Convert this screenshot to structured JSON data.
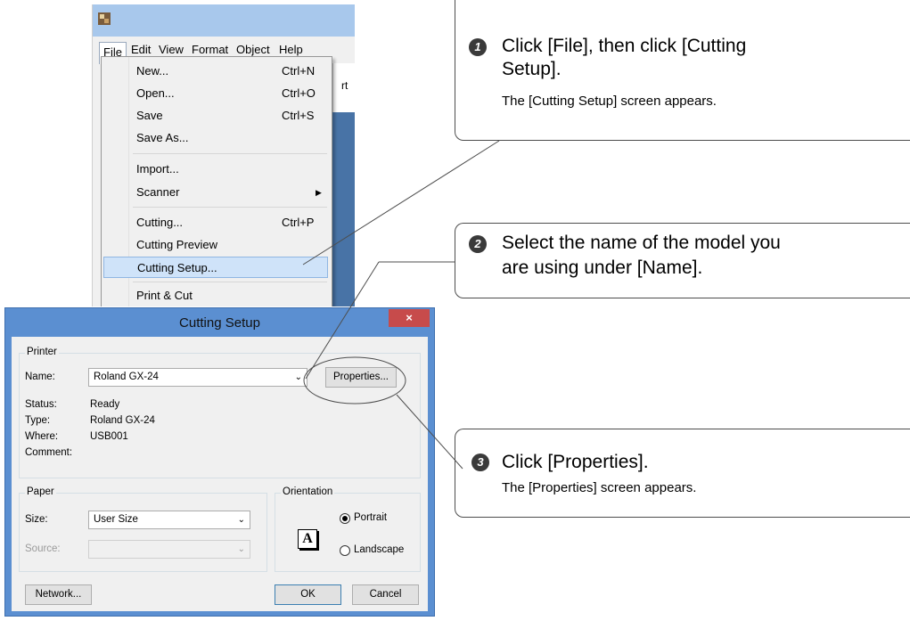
{
  "app": {
    "menubar": [
      "File",
      "Edit",
      "View",
      "Format",
      "Object",
      "Help"
    ],
    "toolbar_fragment": "rt",
    "file_menu": [
      {
        "label": "New...",
        "shortcut": "Ctrl+N"
      },
      {
        "label": "Open...",
        "shortcut": "Ctrl+O"
      },
      {
        "label": "Save",
        "shortcut": "Ctrl+S"
      },
      {
        "label": "Save As...",
        "shortcut": ""
      },
      {
        "label": "Import...",
        "shortcut": ""
      },
      {
        "label": "Scanner",
        "shortcut": "",
        "submenu_icon": "arrow-right-icon"
      },
      {
        "label": "Cutting...",
        "shortcut": "Ctrl+P"
      },
      {
        "label": "Cutting Preview",
        "shortcut": ""
      },
      {
        "label": "Cutting Setup...",
        "shortcut": "",
        "highlighted": true
      },
      {
        "label": "Print & Cut",
        "shortcut": ""
      }
    ]
  },
  "dialog": {
    "title": "Cutting Setup",
    "close": "×",
    "printer_group": "Printer",
    "name_label": "Name:",
    "name_value": "Roland GX-24",
    "properties_button": "Properties...",
    "status_label": "Status:",
    "status_value": "Ready",
    "type_label": "Type:",
    "type_value": "Roland GX-24",
    "where_label": "Where:",
    "where_value": "USB001",
    "comment_label": "Comment:",
    "paper_group": "Paper",
    "size_label": "Size:",
    "size_value": "User Size",
    "source_label": "Source:",
    "orientation_group": "Orientation",
    "orientation_icon_letter": "A",
    "portrait_label": "Portrait",
    "landscape_label": "Landscape",
    "network_button": "Network...",
    "ok_button": "OK",
    "cancel_button": "Cancel"
  },
  "steps": [
    {
      "number": "1",
      "main": "Click [File], then click [Cutting Setup].",
      "main_line1": "Click [File], then click [Cutting",
      "main_line2": "Setup].",
      "sub": "The [Cutting Setup] screen appears."
    },
    {
      "number": "2",
      "main_line1": "Select the name of the model you",
      "main_line2": "are using under [Name].",
      "sub": ""
    },
    {
      "number": "3",
      "main_line1": "Click [Properties].",
      "main_line2": "",
      "sub": "The [Properties] screen appears."
    }
  ],
  "colors": {
    "titlebar": "#a8c8ec",
    "dialog_frame": "#5b8fd1",
    "close_button": "#c74b4b",
    "menu_highlight": "#cfe3f9"
  }
}
